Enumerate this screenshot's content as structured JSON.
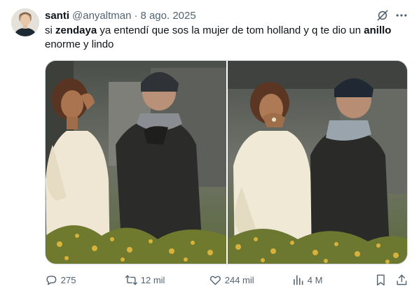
{
  "author": {
    "display_name": "santi",
    "handle": "@anyaltman",
    "separator": "·",
    "date": "8 ago. 2025",
    "avatar_icon": "user-avatar"
  },
  "tweet": {
    "text_1": "si ",
    "bold_1": "zendaya",
    "text_2": " ya entendí que sos la mujer de tom holland y q te dio un ",
    "bold_2": "anillo",
    "text_3": " enorme y lindo"
  },
  "header_icons": {
    "grok": "grok-icon",
    "more": "more-icon"
  },
  "media": {
    "photo_count": 2
  },
  "actions": {
    "replies": "275",
    "reposts": "12 mil",
    "likes": "244 mil",
    "views": "4 M"
  },
  "colors": {
    "text_primary": "#0f1419",
    "text_secondary": "#536471",
    "border": "#cfd9de"
  }
}
